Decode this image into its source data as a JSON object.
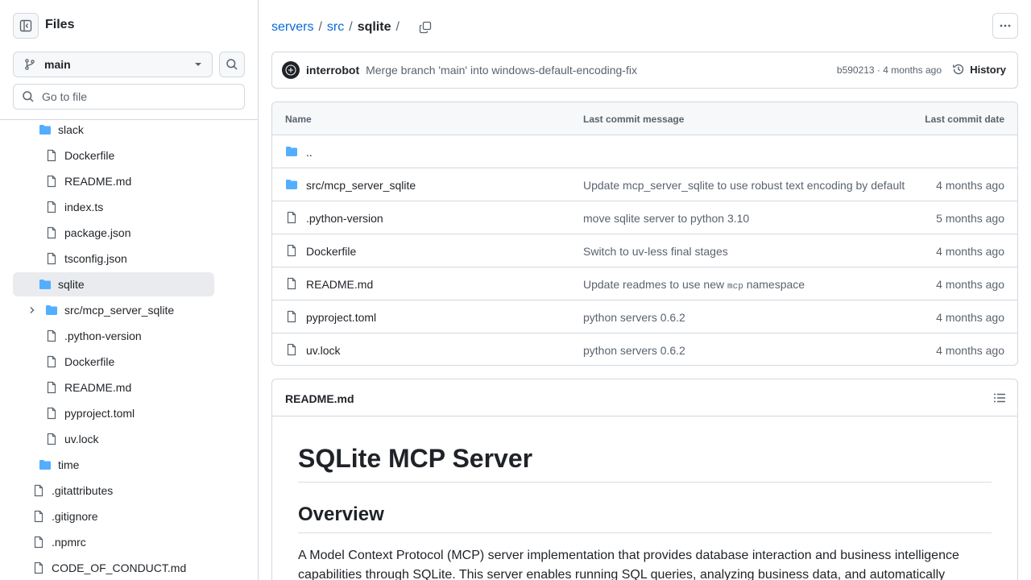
{
  "sidebar": {
    "title": "Files",
    "branch": "main",
    "goto_placeholder": "Go to file",
    "tree": [
      {
        "label": "slack",
        "type": "folder"
      },
      {
        "label": "Dockerfile",
        "type": "file"
      },
      {
        "label": "README.md",
        "type": "file"
      },
      {
        "label": "index.ts",
        "type": "file"
      },
      {
        "label": "package.json",
        "type": "file"
      },
      {
        "label": "tsconfig.json",
        "type": "file"
      },
      {
        "label": "sqlite",
        "type": "folder",
        "selected": true
      },
      {
        "label": "src/mcp_server_sqlite",
        "type": "folder",
        "collapsed": true
      },
      {
        "label": ".python-version",
        "type": "file"
      },
      {
        "label": "Dockerfile",
        "type": "file"
      },
      {
        "label": "README.md",
        "type": "file"
      },
      {
        "label": "pyproject.toml",
        "type": "file"
      },
      {
        "label": "uv.lock",
        "type": "file"
      },
      {
        "label": "time",
        "type": "folder"
      },
      {
        "label": ".gitattributes",
        "type": "file"
      },
      {
        "label": ".gitignore",
        "type": "file"
      },
      {
        "label": ".npmrc",
        "type": "file"
      },
      {
        "label": "CODE_OF_CONDUCT.md",
        "type": "file"
      }
    ]
  },
  "breadcrumb": {
    "parts": [
      "servers",
      "src"
    ],
    "current": "sqlite",
    "sep": "/"
  },
  "commit": {
    "author": "interrobot",
    "message": "Merge branch 'main' into windows-default-encoding-fix",
    "meta": "b590213 · 4 months ago",
    "history_label": "History"
  },
  "files_table": {
    "headers": {
      "name": "Name",
      "message": "Last commit message",
      "date": "Last commit date"
    },
    "parent": "..",
    "rows": [
      {
        "name": "src/mcp_server_sqlite",
        "type": "folder",
        "message": "Update mcp_server_sqlite to use robust text encoding by default",
        "date": "4 months ago"
      },
      {
        "name": ".python-version",
        "type": "file",
        "message": "move sqlite server to python 3.10",
        "date": "5 months ago"
      },
      {
        "name": "Dockerfile",
        "type": "file",
        "message": "Switch to uv-less final stages",
        "date": "4 months ago"
      },
      {
        "name": "README.md",
        "type": "file",
        "message_pre": "Update readmes to use new ",
        "message_code": "mcp",
        "message_post": " namespace",
        "date": "4 months ago"
      },
      {
        "name": "pyproject.toml",
        "type": "file",
        "message": "python servers 0.6.2",
        "date": "4 months ago"
      },
      {
        "name": "uv.lock",
        "type": "file",
        "message": "python servers 0.6.2",
        "date": "4 months ago"
      }
    ]
  },
  "readme": {
    "filename": "README.md",
    "h1": "SQLite MCP Server",
    "h2": "Overview",
    "paragraph": "A Model Context Protocol (MCP) server implementation that provides database interaction and business intelligence capabilities through SQLite. This server enables running SQL queries, analyzing business data, and automatically"
  },
  "colors": {
    "link": "#0969da",
    "folder": "#54aeff",
    "muted": "#59636e",
    "border": "#d1d9e0"
  }
}
